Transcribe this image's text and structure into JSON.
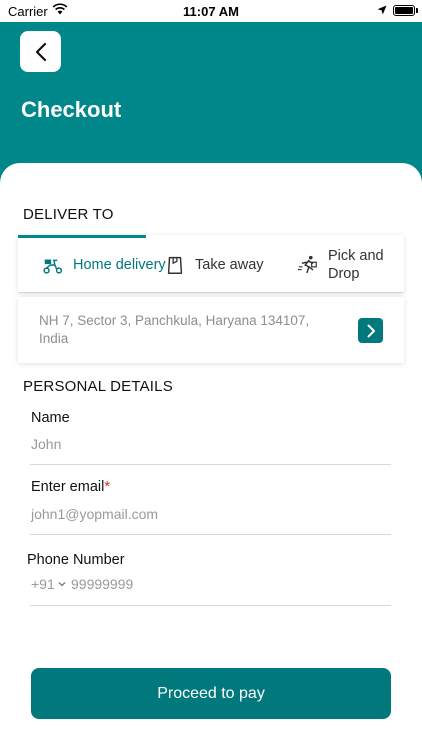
{
  "status_bar": {
    "carrier": "Carrier",
    "time": "11:07 AM"
  },
  "header": {
    "title": "Checkout"
  },
  "deliver_to": {
    "title": "DELIVER TO",
    "tabs": [
      {
        "label": "Home delivery",
        "icon": "scooter-icon",
        "selected": true
      },
      {
        "label": "Take away",
        "icon": "bag-icon",
        "selected": false
      },
      {
        "label": "Pick and Drop",
        "icon": "runner-icon",
        "selected": false
      }
    ],
    "address": "NH 7, Sector 3, Panchkula, Haryana 134107, India"
  },
  "personal_details": {
    "title": "PERSONAL DETAILS",
    "name": {
      "label": "Name",
      "value": "John"
    },
    "email": {
      "label": "Enter email",
      "required_mark": "*",
      "value": "john1@yopmail.com"
    },
    "phone": {
      "label": "Phone Number",
      "country_code": "+91",
      "value": "99999999"
    }
  },
  "actions": {
    "proceed_label": "Proceed to pay"
  },
  "colors": {
    "primary": "#00878a",
    "button": "#00787c",
    "required": "#d62b2b"
  }
}
